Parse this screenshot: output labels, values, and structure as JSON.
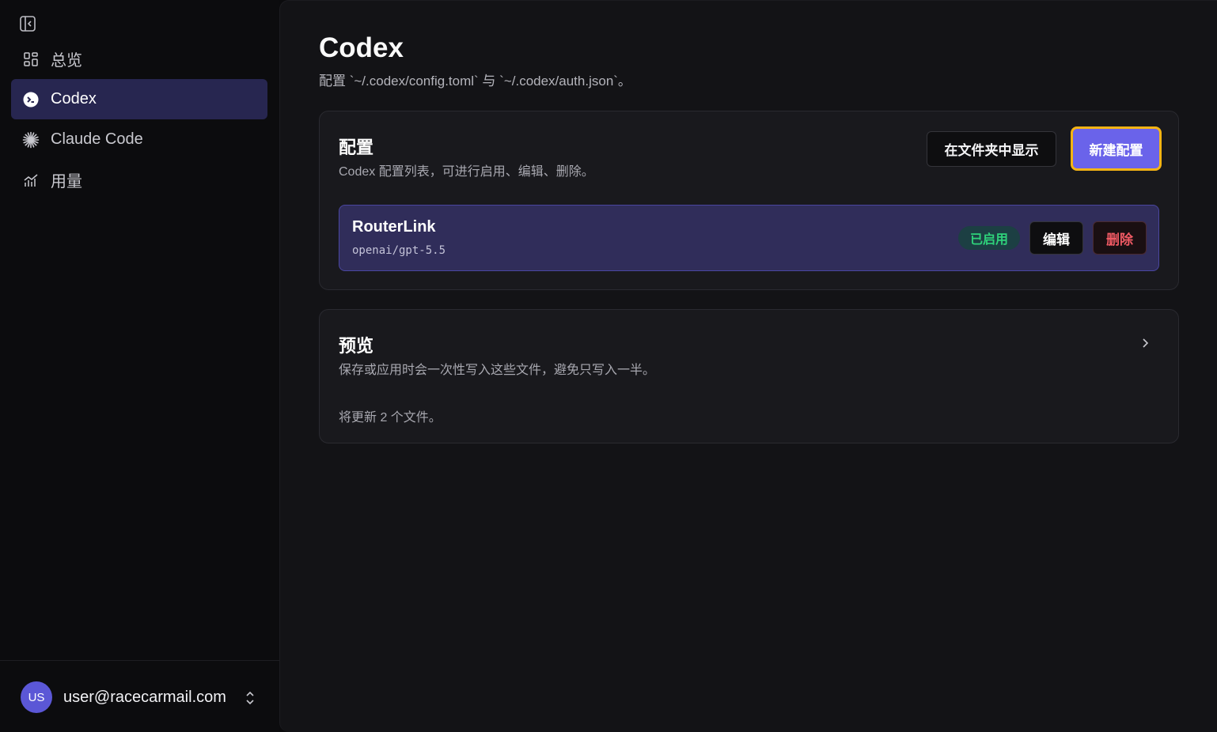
{
  "sidebar": {
    "collapse_icon": "sidebar-collapse-icon",
    "items": [
      {
        "label": "总览",
        "icon": "grid-icon",
        "active": false
      },
      {
        "label": "Codex",
        "icon": "codex-icon",
        "active": true
      },
      {
        "label": "Claude Code",
        "icon": "claude-asterisk-icon",
        "active": false
      },
      {
        "label": "用量",
        "icon": "chart-icon",
        "active": false
      }
    ],
    "account": {
      "avatar_initials": "US",
      "email": "user@racecarmail.com",
      "icon": "chevron-up-down-icon"
    }
  },
  "main": {
    "title": "Codex",
    "subtitle": "配置 `~/.codex/config.toml` 与 `~/.codex/auth.json`。",
    "config_card": {
      "title": "配置",
      "description": "Codex 配置列表，可进行启用、编辑、删除。",
      "show_in_folder_label": "在文件夹中显示",
      "new_config_label": "新建配置",
      "profiles": [
        {
          "name": "RouterLink",
          "model": "openai/gpt-5.5",
          "status_label": "已启用",
          "edit_label": "编辑",
          "delete_label": "删除"
        }
      ]
    },
    "preview_card": {
      "title": "预览",
      "description": "保存或应用时会一次性写入这些文件，避免只写入一半。",
      "note": "将更新 2 个文件。",
      "icon": "chevron-right-icon"
    }
  },
  "colors": {
    "accent": "#6a63ea",
    "active_nav": "#272650",
    "focus_ring": "#f5b414",
    "enabled_text": "#2fd27a",
    "danger": "#f05a64"
  }
}
